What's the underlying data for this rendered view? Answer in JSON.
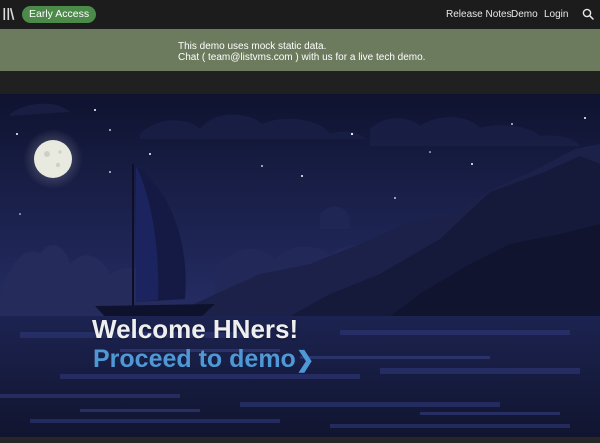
{
  "header": {
    "badge": "Early Access",
    "nav": {
      "release_notes": "Release Notes",
      "demo": "Demo",
      "login": "Login"
    },
    "search_icon": "search-icon",
    "logo_icon": "bars-logo-icon"
  },
  "banner": {
    "line1": "This demo uses mock static data.",
    "line2": "Chat ( team@listvms.com ) with us for a live tech demo."
  },
  "hero": {
    "title": "Welcome HNers!",
    "cta": "Proceed to demo",
    "cta_arrow": "❯"
  },
  "colors": {
    "topbar": "#1c1c1c",
    "badge": "#4c8a4a",
    "banner": "#6c7a5d",
    "cta": "#4f98d6",
    "sky_top": "#0f1330",
    "sky_bottom": "#2b3370"
  }
}
